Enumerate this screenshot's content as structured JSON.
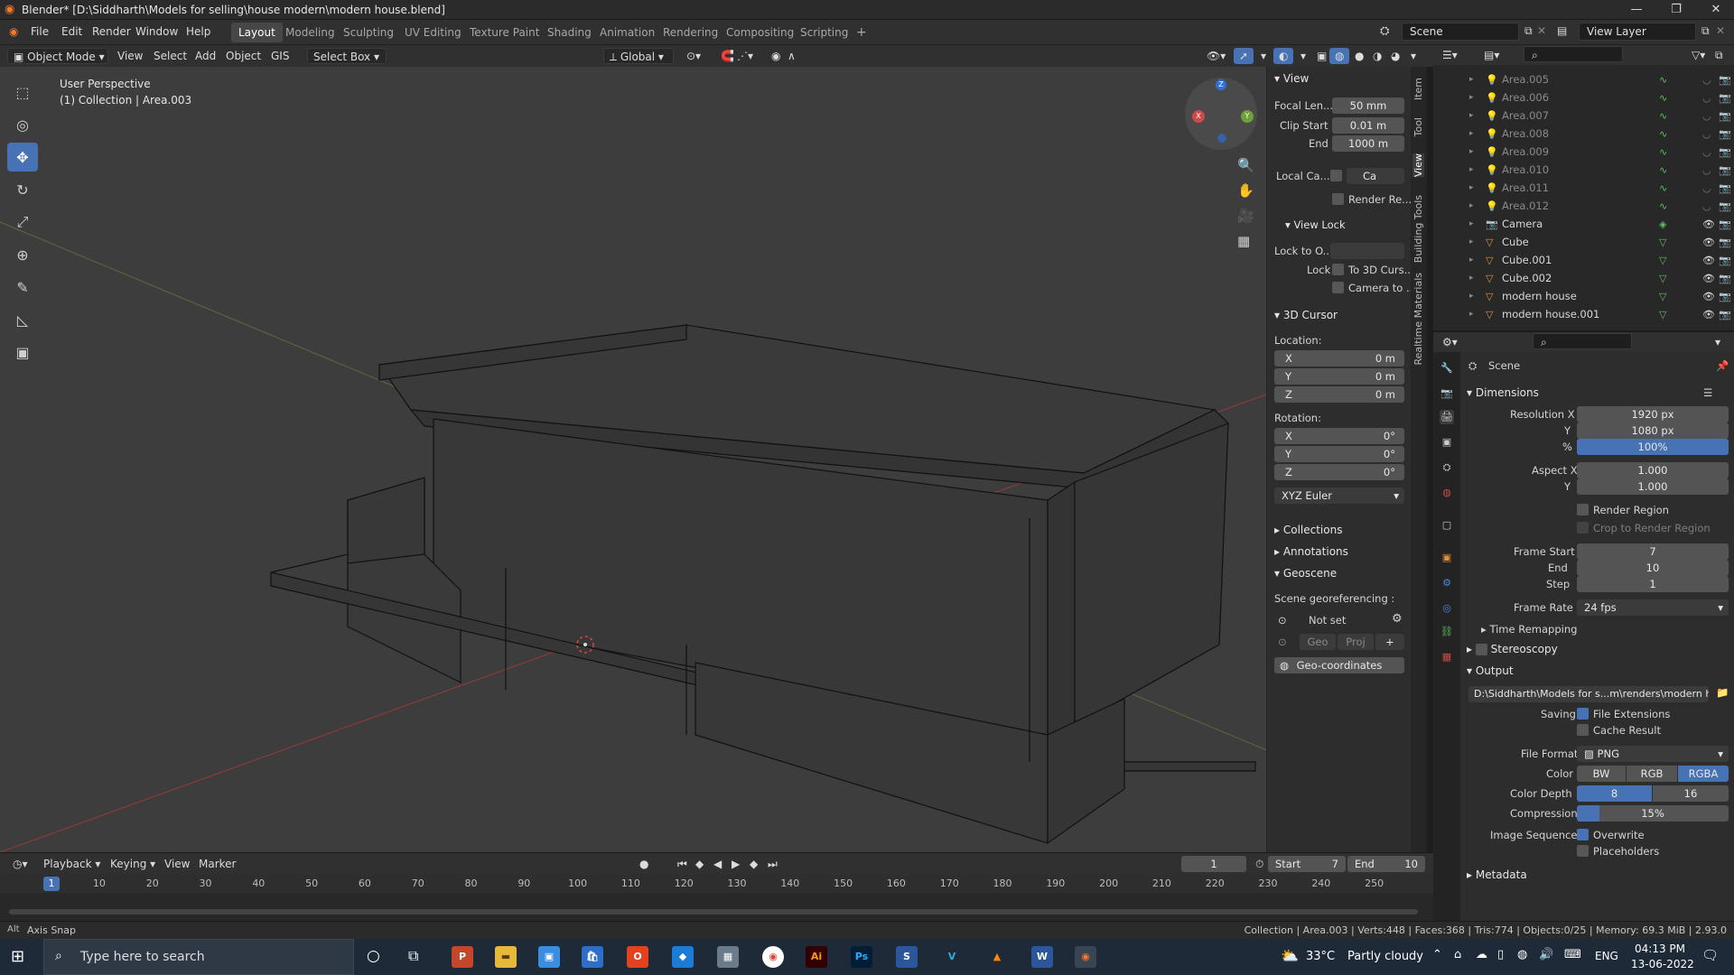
{
  "window": {
    "title": "Blender* [D:\\Siddharth\\Models for selling\\house modern\\modern house.blend]",
    "controls": [
      "—",
      "❐",
      "✕"
    ]
  },
  "topbar": {
    "menus": [
      "File",
      "Edit",
      "Render",
      "Window",
      "Help"
    ],
    "workspaces": [
      "Layout",
      "Modeling",
      "Sculpting",
      "UV Editing",
      "Texture Paint",
      "Shading",
      "Animation",
      "Rendering",
      "Compositing",
      "Scripting"
    ],
    "active_workspace": "Layout",
    "add_tab": "+",
    "scene_label": "Scene",
    "view_layer_label": "View Layer"
  },
  "viewport_header": {
    "mode": "Object Mode",
    "menus": [
      "View",
      "Select",
      "Add",
      "Object",
      "GIS"
    ],
    "select_tool": "Select Box",
    "transform_orientation": "Global"
  },
  "viewport": {
    "perspective_label": "User Perspective",
    "collection_label": "(1) Collection | Area.003",
    "gizmo": {
      "x": "X",
      "y": "Y",
      "z": "Z"
    }
  },
  "tools": [
    {
      "name": "select-box-tool",
      "glyph": "⬚",
      "active": false
    },
    {
      "name": "cursor-tool",
      "glyph": "◎",
      "active": false
    },
    {
      "name": "move-tool",
      "glyph": "✥",
      "active": true
    },
    {
      "name": "rotate-tool",
      "glyph": "↻",
      "active": false
    },
    {
      "name": "scale-tool",
      "glyph": "⤢",
      "active": false
    },
    {
      "name": "transform-tool",
      "glyph": "⊕",
      "active": false
    },
    {
      "name": "annotate-tool",
      "glyph": "✎",
      "active": false
    },
    {
      "name": "measure-tool",
      "glyph": "📐",
      "active": false
    },
    {
      "name": "add-cube-tool",
      "glyph": "⬛",
      "active": false
    }
  ],
  "npanel": {
    "view_title": "View",
    "focal_length_label": "Focal Len...",
    "focal_length": "50 mm",
    "clip_start_label": "Clip Start",
    "clip_start": "0.01 m",
    "clip_end_label": "End",
    "clip_end": "1000 m",
    "local_camera_label": "Local Ca...",
    "local_camera_value": "Ca",
    "render_region_label": "Render Re...",
    "view_lock_title": "View Lock",
    "lock_to_object_label": "Lock to O...",
    "lock_label": "Lock",
    "to_3d_cursor": "To 3D Curs...",
    "camera_to": "Camera to ...",
    "cursor_title": "3D Cursor",
    "location_label": "Location:",
    "loc_x": "0 m",
    "loc_y": "0 m",
    "loc_z": "0 m",
    "rotation_label": "Rotation:",
    "rot_x": "0°",
    "rot_y": "0°",
    "rot_z": "0°",
    "axis_x": "X",
    "axis_y": "Y",
    "axis_z": "Z",
    "rotation_mode": "XYZ Euler",
    "collections_title": "Collections",
    "annotations_title": "Annotations",
    "geoscene_title": "Geoscene",
    "georef_label": "Scene georeferencing :",
    "not_set": "Not set",
    "geo_btn": "Geo",
    "proj_btn": "Proj",
    "geocoords_btn": "Geo-coordinates"
  },
  "vertical_tabs": [
    "Item",
    "Tool",
    "View",
    "Building Tools",
    "Realtime Materials"
  ],
  "outliner": {
    "items": [
      {
        "name": "Area.005",
        "type": "light"
      },
      {
        "name": "Area.006",
        "type": "light"
      },
      {
        "name": "Area.007",
        "type": "light"
      },
      {
        "name": "Area.008",
        "type": "light"
      },
      {
        "name": "Area.009",
        "type": "light"
      },
      {
        "name": "Area.010",
        "type": "light"
      },
      {
        "name": "Area.011",
        "type": "light"
      },
      {
        "name": "Area.012",
        "type": "light"
      },
      {
        "name": "Camera",
        "type": "camera"
      },
      {
        "name": "Cube",
        "type": "mesh"
      },
      {
        "name": "Cube.001",
        "type": "mesh"
      },
      {
        "name": "Cube.002",
        "type": "mesh"
      },
      {
        "name": "modern house",
        "type": "mesh"
      },
      {
        "name": "modern house.001",
        "type": "mesh"
      }
    ]
  },
  "properties": {
    "context": "Scene",
    "dimensions_title": "Dimensions",
    "res_x_label": "Resolution X",
    "res_x": "1920 px",
    "res_y_label": "Y",
    "res_y": "1080 px",
    "res_pct_label": "%",
    "res_pct": "100%",
    "aspect_x_label": "Aspect X",
    "aspect_x": "1.000",
    "aspect_y_label": "Y",
    "aspect_y": "1.000",
    "render_region": "Render Region",
    "crop_region": "Crop to Render Region",
    "frame_start_label": "Frame Start",
    "frame_start": "7",
    "frame_end_label": "End",
    "frame_end": "10",
    "frame_step_label": "Step",
    "frame_step": "1",
    "frame_rate_label": "Frame Rate",
    "frame_rate": "24 fps",
    "time_remapping": "Time Remapping",
    "stereoscopy": "Stereoscopy",
    "output_title": "Output",
    "output_path": "D:\\Siddharth\\Models for s...m\\renders\\modern house",
    "saving_label": "Saving",
    "file_extensions": "File Extensions",
    "cache_result": "Cache Result",
    "file_format_label": "File Format",
    "file_format": "PNG",
    "color_label": "Color",
    "color_opts": [
      "BW",
      "RGB",
      "RGBA"
    ],
    "color_active": "RGBA",
    "color_depth_label": "Color Depth",
    "depth_opts": [
      "8",
      "16"
    ],
    "compression_label": "Compression",
    "compression": "15%",
    "compression_fraction": 0.15,
    "image_sequence_label": "Image Sequence",
    "overwrite": "Overwrite",
    "placeholders": "Placeholders",
    "metadata_title": "Metadata"
  },
  "timeline": {
    "menus": [
      "Playback",
      "Keying",
      "View",
      "Marker"
    ],
    "current_frame": "1",
    "start_label": "Start",
    "start": "7",
    "end_label": "End",
    "end": "10",
    "ruler": [
      "10",
      "20",
      "30",
      "40",
      "50",
      "60",
      "70",
      "80",
      "90",
      "100",
      "110",
      "120",
      "130",
      "140",
      "150",
      "160",
      "170",
      "180",
      "190",
      "200",
      "210",
      "220",
      "230",
      "240",
      "250"
    ],
    "playhead": "1"
  },
  "statusbar": {
    "left": "Axis Snap",
    "right": "Collection | Area.003 | Verts:448 | Faces:368 | Tris:774 | Objects:0/25 | Memory: 69.3 MiB | 2.93.0"
  },
  "taskbar": {
    "search_placeholder": "Type here to search",
    "weather_temp": "33°C",
    "weather_desc": "Partly cloudy",
    "lang": "ENG",
    "time": "04:13 PM",
    "date": "13-06-2022"
  },
  "colors": {
    "accent": "#4772b3",
    "viewport": "#3d3d3d",
    "panel": "#2d2d2d"
  }
}
